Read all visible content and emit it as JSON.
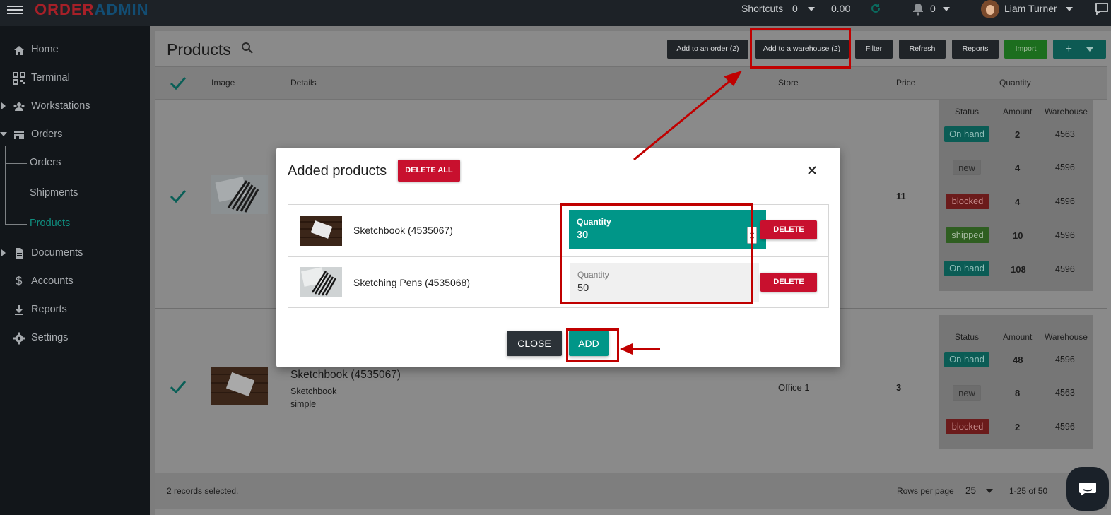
{
  "app": {
    "logo_part1": "ORDER",
    "logo_part2": "ADMIN"
  },
  "topbar": {
    "shortcuts_label": "Shortcuts",
    "shortcuts_count": "0",
    "balance": "0.00",
    "notifications_count": "0",
    "user_name": "Liam Turner"
  },
  "sidebar": {
    "items": [
      {
        "label": "Home",
        "icon": "home-icon"
      },
      {
        "label": "Terminal",
        "icon": "qr-code-icon"
      },
      {
        "label": "Workstations",
        "icon": "people-icon"
      },
      {
        "label": "Orders",
        "icon": "store-icon"
      },
      {
        "label": "Documents",
        "icon": "document-icon"
      },
      {
        "label": "Accounts",
        "icon": "dollar-icon"
      },
      {
        "label": "Reports",
        "icon": "download-icon"
      },
      {
        "label": "Settings",
        "icon": "gear-icon"
      }
    ],
    "sub_items": [
      "Orders",
      "Shipments",
      "Products"
    ],
    "active_sub": "Products"
  },
  "page": {
    "title": "Products",
    "buttons": {
      "add_to_order": "Add to an order (2)",
      "add_to_warehouse": "Add to a warehouse (2)",
      "filter": "Filter",
      "refresh": "Refresh",
      "reports": "Reports",
      "import": "Import",
      "plus": "+"
    },
    "columns": {
      "image": "Image",
      "details": "Details",
      "store": "Store",
      "price": "Price",
      "quantity": "Quantity"
    },
    "qty_columns": {
      "status": "Status",
      "amount": "Amount",
      "warehouse": "Warehouse"
    },
    "rows": [
      {
        "price": "11",
        "quantities": [
          {
            "status": "On hand",
            "amount": "2",
            "warehouse": "4563"
          },
          {
            "status": "new",
            "amount": "4",
            "warehouse": "4596"
          },
          {
            "status": "blocked",
            "amount": "4",
            "warehouse": "4596"
          },
          {
            "status": "shipped",
            "amount": "10",
            "warehouse": "4596"
          },
          {
            "status": "On hand",
            "amount": "108",
            "warehouse": "4596"
          }
        ]
      },
      {
        "name": "Sketchbook (4535067)",
        "sub": "Sketchbook",
        "type": "simple",
        "store": "Office 1",
        "price": "3",
        "quantities": [
          {
            "status": "On hand",
            "amount": "48",
            "warehouse": "4596"
          },
          {
            "status": "new",
            "amount": "8",
            "warehouse": "4563"
          },
          {
            "status": "blocked",
            "amount": "2",
            "warehouse": "4596"
          }
        ]
      }
    ],
    "footer": {
      "selected": "2 records selected.",
      "rows_per_page_label": "Rows per page",
      "rows_per_page": "25",
      "range": "1-25 of 50"
    }
  },
  "modal": {
    "title": "Added products",
    "delete_all": "DELETE ALL",
    "items": [
      {
        "name": "Sketchbook (4535067)",
        "qty_label": "Quantity",
        "qty": "30",
        "delete": "DELETE"
      },
      {
        "name": "Sketching Pens (4535068)",
        "qty_label": "Quantity",
        "qty": "50",
        "delete": "DELETE"
      }
    ],
    "close": "CLOSE",
    "add": "ADD"
  },
  "colors": {
    "teal": "#009688",
    "red": "#c8102e",
    "annotation": "#c00000",
    "sidebar_bg": "#12161a"
  }
}
